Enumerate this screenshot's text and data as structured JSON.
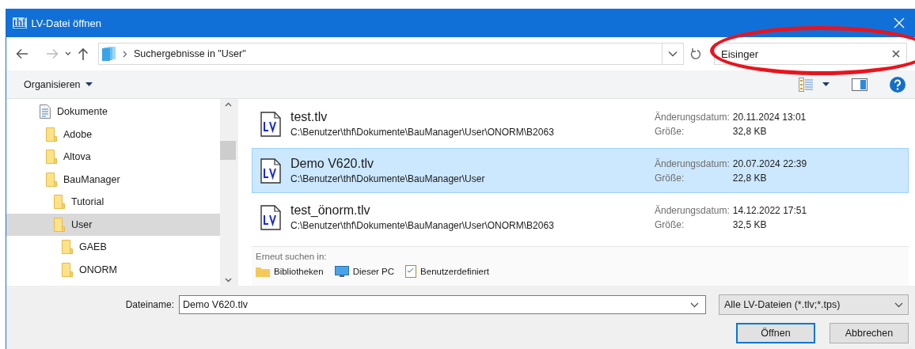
{
  "window": {
    "app_icon": "thf",
    "title": "LV-Datei öffnen"
  },
  "address": {
    "location": "Suchergebnisse in \"User\""
  },
  "search": {
    "value": "Eisinger"
  },
  "toolbar": {
    "organize": "Organisieren"
  },
  "nav_tree": [
    {
      "label": "Dokumente",
      "kind": "documents",
      "selected": false,
      "children": [
        {
          "label": "Adobe",
          "kind": "folder",
          "selected": false
        },
        {
          "label": "Altova",
          "kind": "folder",
          "selected": false
        },
        {
          "label": "BauManager",
          "kind": "folder",
          "selected": false,
          "children": [
            {
              "label": "Tutorial",
              "kind": "folder",
              "selected": false
            },
            {
              "label": "User",
              "kind": "folder",
              "selected": true,
              "children": [
                {
                  "label": "GAEB",
                  "kind": "folder",
                  "selected": false
                },
                {
                  "label": "ONORM",
                  "kind": "folder",
                  "selected": false
                }
              ]
            }
          ]
        }
      ]
    }
  ],
  "results": [
    {
      "name": "test.tlv",
      "path": "C:\\Benutzer\\thf\\Dokumente\\BauManager\\User\\ONORM\\B2063",
      "date_label": "Änderungsdatum:",
      "date": "20.11.2024 13:01",
      "size_label": "Größe:",
      "size": "32,8 KB",
      "selected": false
    },
    {
      "name": "Demo V620.tlv",
      "path": "C:\\Benutzer\\thf\\Dokumente\\BauManager\\User",
      "date_label": "Änderungsdatum:",
      "date": "20.07.2024 22:39",
      "size_label": "Größe:",
      "size": "22,8 KB",
      "selected": true
    },
    {
      "name": "test_önorm.tlv",
      "path": "C:\\Benutzer\\thf\\Dokumente\\BauManager\\User\\ONORM\\B2063",
      "date_label": "Änderungsdatum:",
      "date": "14.12.2022 17:51",
      "size_label": "Größe:",
      "size": "32,5 KB",
      "selected": false
    }
  ],
  "search_again": {
    "label": "Erneut suchen in:",
    "locations": [
      {
        "label": "Bibliotheken",
        "kind": "libraries"
      },
      {
        "label": "Dieser PC",
        "kind": "computer"
      },
      {
        "label": "Benutzerdefiniert",
        "kind": "custom"
      }
    ]
  },
  "filename": {
    "label": "Dateiname:",
    "value": "Demo V620.tlv"
  },
  "filter": {
    "value": "Alle LV-Dateien (*.tlv;*.tps)"
  },
  "buttons": [
    {
      "label": "Öffnen",
      "kind": "primary"
    },
    {
      "label": "Abbrechen",
      "kind": "normal"
    }
  ]
}
